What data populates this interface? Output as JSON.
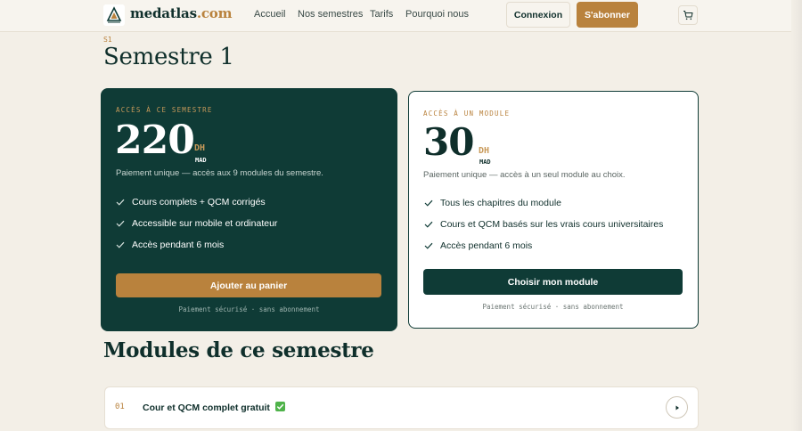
{
  "header": {
    "brand_name": "medatlas",
    "brand_tld": ".com",
    "nav": [
      "Accueil",
      "Nos semestres",
      "Tarifs",
      "Pourquoi nous"
    ],
    "login_label": "Connexion",
    "subscribe_label": "S'abonner"
  },
  "page": {
    "crumb": "S1",
    "title": "Semestre 1"
  },
  "plans": [
    {
      "eyebrow": "ACCÈS À CE SEMESTRE",
      "price": "220",
      "currency": "DH",
      "currency_code": "MAD",
      "description": "Paiement unique — accès aux 9 modules du semestre.",
      "features": [
        "Cours complets + QCM corrigés",
        "Accessible sur mobile et ordinateur",
        "Accès pendant 6 mois"
      ],
      "cta": "Ajouter au panier",
      "note": "Paiement sécurisé · sans abonnement"
    },
    {
      "eyebrow": "ACCÈS À UN MODULE",
      "price": "30",
      "currency": "DH",
      "currency_code": "MAD",
      "description": "Paiement unique — accès à un seul module au choix.",
      "features": [
        "Tous les chapitres du module",
        "Cours et QCM basés sur les vrais cours universitaires",
        "Accès pendant 6 mois"
      ],
      "cta": "Choisir mon module",
      "note": "Paiement sécurisé · sans abonnement"
    }
  ],
  "modules": {
    "title": "Modules de ce semestre",
    "items": [
      {
        "number": "01",
        "title": "Cour et QCM complet gratuit"
      }
    ]
  },
  "colors": {
    "primary": "#0f3b36",
    "accent": "#b9823d",
    "background": "#f3efe7"
  },
  "icons": [
    "logo-icon",
    "cart-icon",
    "check-icon",
    "check-mark-emoji-icon",
    "play-icon"
  ]
}
